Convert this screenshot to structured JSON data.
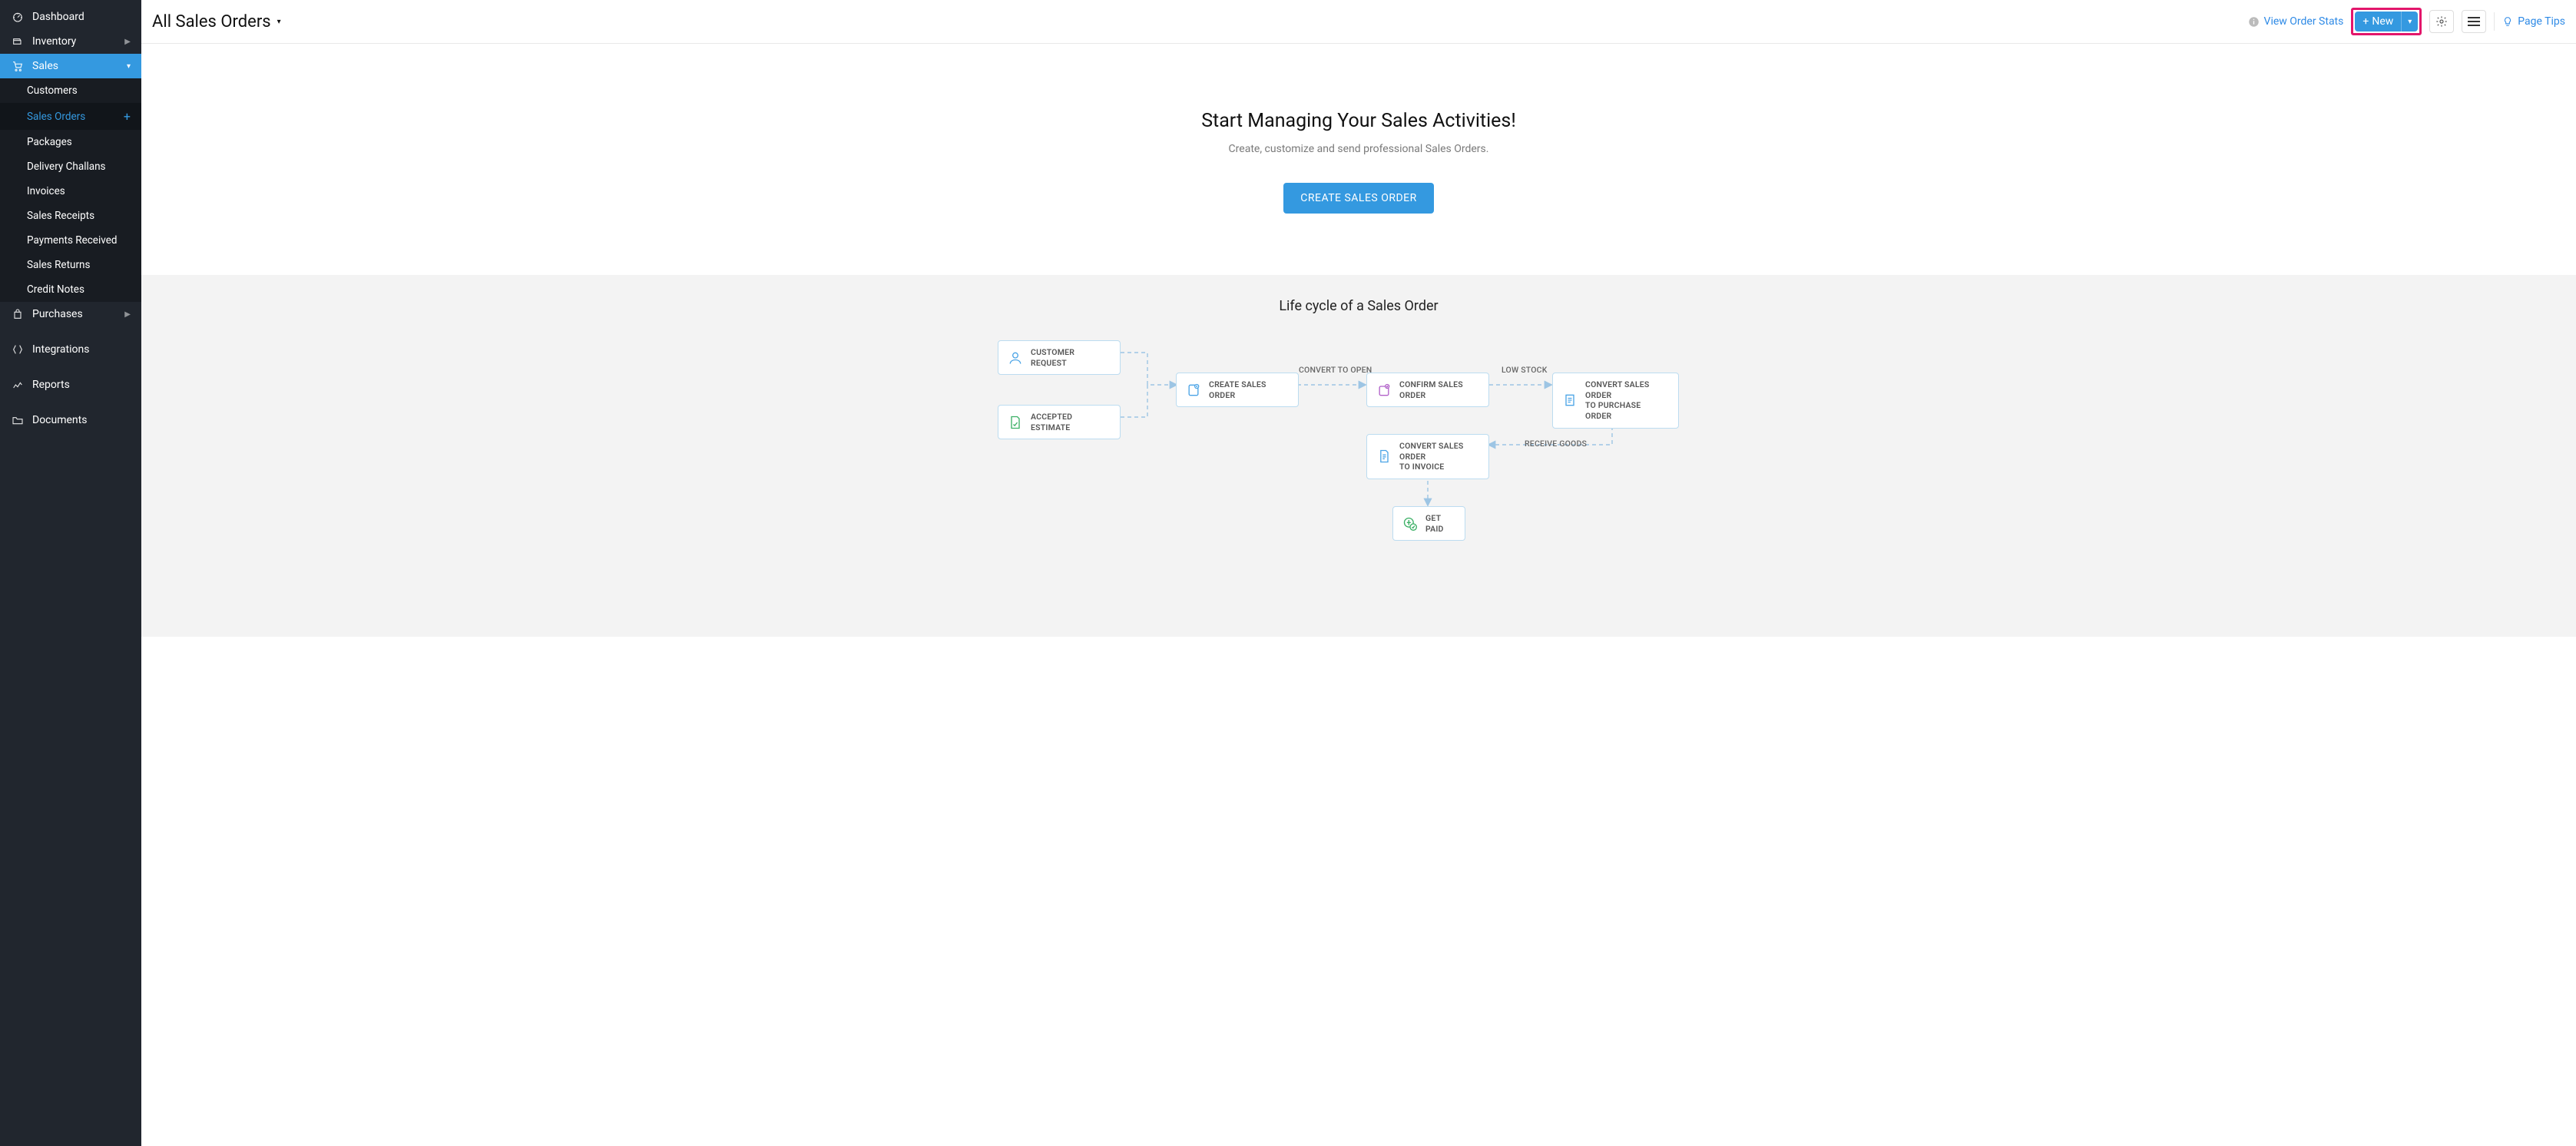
{
  "sidebar": {
    "items": [
      {
        "label": "Dashboard",
        "icon": "dashboard"
      },
      {
        "label": "Inventory",
        "icon": "inventory",
        "caret": true
      },
      {
        "label": "Sales",
        "icon": "cart",
        "caret": true,
        "active": true
      },
      {
        "label": "Purchases",
        "icon": "bag",
        "caret": true
      },
      {
        "label": "Integrations",
        "icon": "integrations"
      },
      {
        "label": "Reports",
        "icon": "reports"
      },
      {
        "label": "Documents",
        "icon": "folder"
      }
    ],
    "sales_sub": [
      {
        "label": "Customers"
      },
      {
        "label": "Sales Orders",
        "active": true,
        "plus": true
      },
      {
        "label": "Packages"
      },
      {
        "label": "Delivery Challans"
      },
      {
        "label": "Invoices"
      },
      {
        "label": "Sales Receipts"
      },
      {
        "label": "Payments Received"
      },
      {
        "label": "Sales Returns"
      },
      {
        "label": "Credit Notes"
      }
    ]
  },
  "topbar": {
    "title": "All Sales Orders",
    "view_stats": "View Order Stats",
    "new_label": "New",
    "page_tips": "Page Tips"
  },
  "empty": {
    "heading": "Start Managing Your Sales Activities!",
    "sub": "Create, customize and send professional Sales Orders.",
    "cta": "CREATE SALES ORDER"
  },
  "lifecycle": {
    "title": "Life cycle of a Sales Order",
    "nodes": {
      "customer_request": "CUSTOMER REQUEST",
      "accepted_estimate": "ACCEPTED ESTIMATE",
      "create_sales_order": "CREATE SALES ORDER",
      "confirm_sales_order": "CONFIRM SALES ORDER",
      "convert_to_po_l1": "CONVERT SALES ORDER",
      "convert_to_po_l2": "TO PURCHASE ORDER",
      "convert_to_invoice_l1": "CONVERT SALES ORDER",
      "convert_to_invoice_l2": "TO INVOICE",
      "get_paid": "GET PAID"
    },
    "labels": {
      "convert_to_open": "CONVERT TO OPEN",
      "low_stock": "LOW STOCK",
      "receive_goods": "RECEIVE GOODS"
    }
  }
}
